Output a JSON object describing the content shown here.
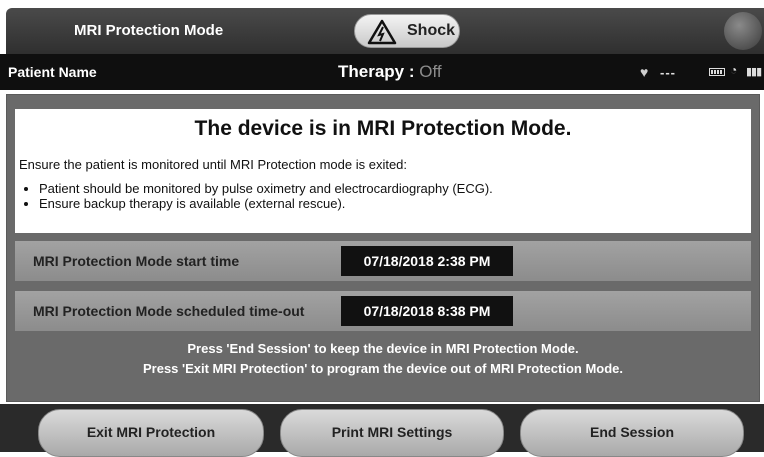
{
  "header": {
    "mode_title": "MRI Protection Mode",
    "shock_label": "Shock"
  },
  "status": {
    "patient_label": "Patient Name",
    "therapy_label": "Therapy : ",
    "therapy_value": "Off",
    "heart_rate": "---"
  },
  "message": {
    "headline": "The device is in MRI Protection Mode.",
    "intro": "Ensure the patient is monitored until MRI Protection mode is exited:",
    "bullets": [
      "Patient should be monitored by pulse oximetry and electrocardiography (ECG).",
      "Ensure backup therapy is available (external rescue)."
    ]
  },
  "times": {
    "start_label": "MRI Protection Mode start time",
    "start_value": "07/18/2018 2:38 PM",
    "timeout_label": "MRI Protection Mode scheduled time-out",
    "timeout_value": "07/18/2018 8:38 PM"
  },
  "instructions": [
    "Press 'End Session' to keep the device in MRI Protection Mode.",
    "Press 'Exit MRI Protection' to program the device out of MRI Protection Mode."
  ],
  "buttons": {
    "exit": "Exit MRI Protection",
    "print": "Print MRI Settings",
    "end": "End Session"
  }
}
